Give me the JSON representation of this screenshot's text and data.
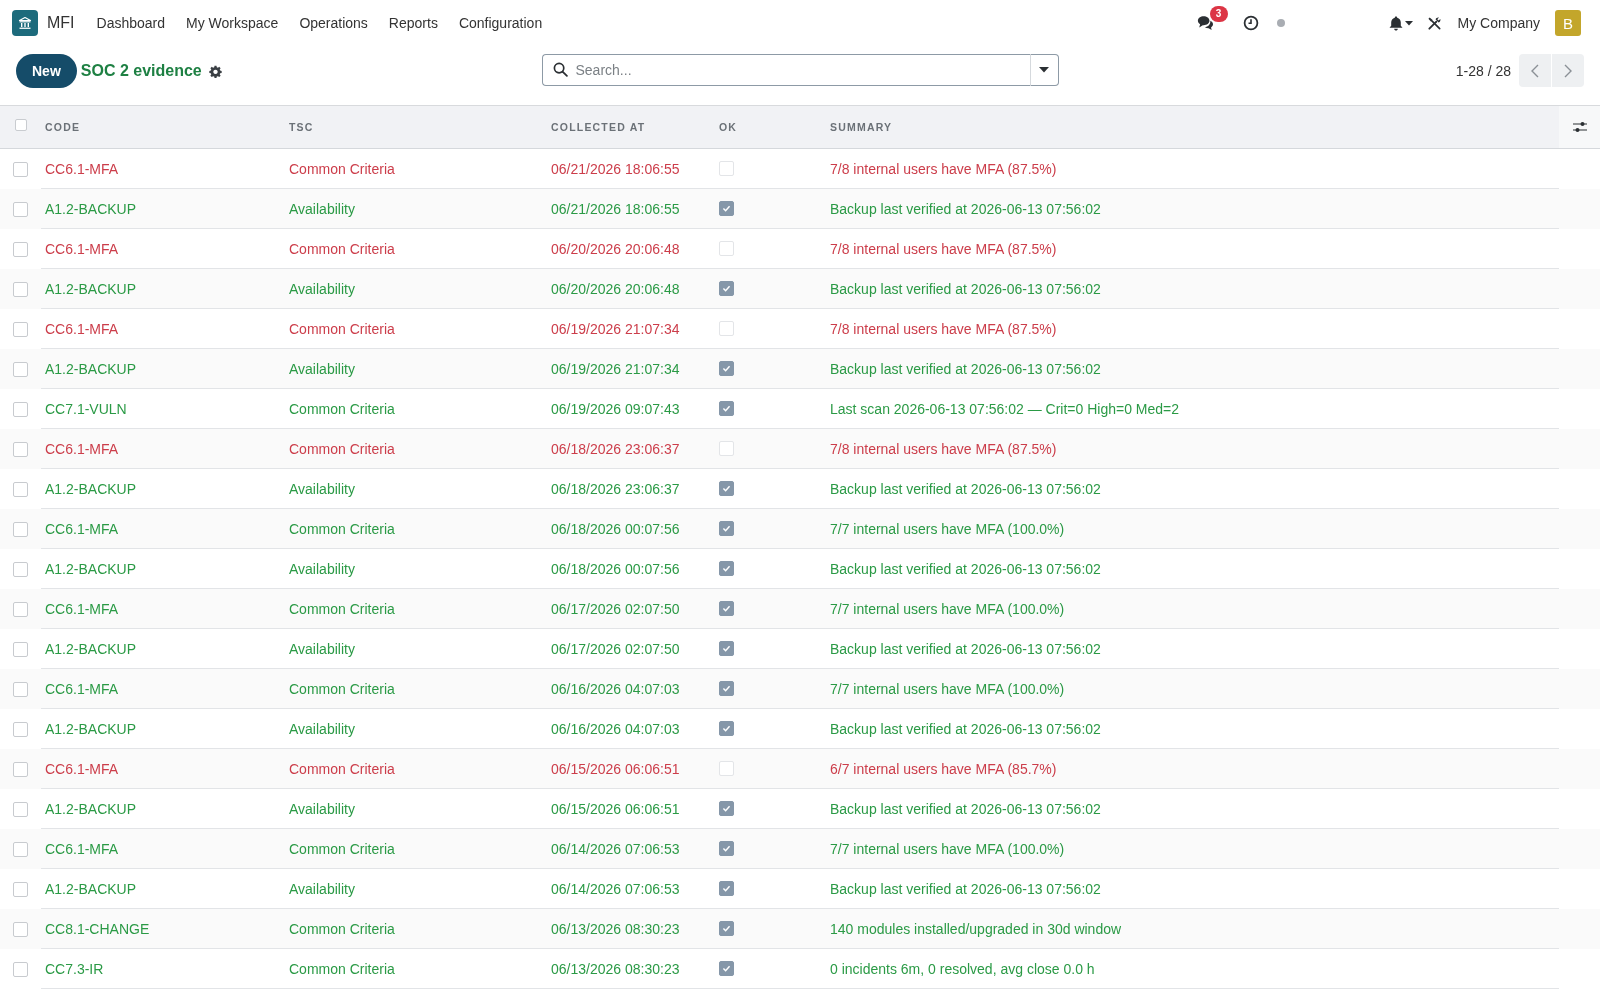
{
  "navbar": {
    "app_name": "MFI",
    "menu": [
      "Dashboard",
      "My Workspace",
      "Operations",
      "Reports",
      "Configuration"
    ],
    "messages_badge": "3",
    "company": "My Company",
    "avatar_initial": "B"
  },
  "control_panel": {
    "new_button": "New",
    "title": "SOC 2 evidence",
    "search": {
      "placeholder": "Search..."
    },
    "pager": "1-28 / 28"
  },
  "table": {
    "select_all": false,
    "columns": [
      "CODE",
      "TSC",
      "COLLECTED AT",
      "OK",
      "SUMMARY"
    ],
    "rows": [
      {
        "selected": false,
        "code": "CC6.1-MFA",
        "tsc": "Common Criteria",
        "collected_at": "06/21/2026 18:06:55",
        "ok": false,
        "summary": "7/8 internal users have MFA (87.5%)"
      },
      {
        "selected": false,
        "code": "A1.2-BACKUP",
        "tsc": "Availability",
        "collected_at": "06/21/2026 18:06:55",
        "ok": true,
        "summary": "Backup last verified at 2026-06-13 07:56:02"
      },
      {
        "selected": false,
        "code": "CC6.1-MFA",
        "tsc": "Common Criteria",
        "collected_at": "06/20/2026 20:06:48",
        "ok": false,
        "summary": "7/8 internal users have MFA (87.5%)"
      },
      {
        "selected": false,
        "code": "A1.2-BACKUP",
        "tsc": "Availability",
        "collected_at": "06/20/2026 20:06:48",
        "ok": true,
        "summary": "Backup last verified at 2026-06-13 07:56:02"
      },
      {
        "selected": false,
        "code": "CC6.1-MFA",
        "tsc": "Common Criteria",
        "collected_at": "06/19/2026 21:07:34",
        "ok": false,
        "summary": "7/8 internal users have MFA (87.5%)"
      },
      {
        "selected": false,
        "code": "A1.2-BACKUP",
        "tsc": "Availability",
        "collected_at": "06/19/2026 21:07:34",
        "ok": true,
        "summary": "Backup last verified at 2026-06-13 07:56:02"
      },
      {
        "selected": false,
        "code": "CC7.1-VULN",
        "tsc": "Common Criteria",
        "collected_at": "06/19/2026 09:07:43",
        "ok": true,
        "summary": "Last scan 2026-06-13 07:56:02 — Crit=0 High=0 Med=2"
      },
      {
        "selected": false,
        "code": "CC6.1-MFA",
        "tsc": "Common Criteria",
        "collected_at": "06/18/2026 23:06:37",
        "ok": false,
        "summary": "7/8 internal users have MFA (87.5%)"
      },
      {
        "selected": false,
        "code": "A1.2-BACKUP",
        "tsc": "Availability",
        "collected_at": "06/18/2026 23:06:37",
        "ok": true,
        "summary": "Backup last verified at 2026-06-13 07:56:02"
      },
      {
        "selected": false,
        "code": "CC6.1-MFA",
        "tsc": "Common Criteria",
        "collected_at": "06/18/2026 00:07:56",
        "ok": true,
        "summary": "7/7 internal users have MFA (100.0%)"
      },
      {
        "selected": false,
        "code": "A1.2-BACKUP",
        "tsc": "Availability",
        "collected_at": "06/18/2026 00:07:56",
        "ok": true,
        "summary": "Backup last verified at 2026-06-13 07:56:02"
      },
      {
        "selected": false,
        "code": "CC6.1-MFA",
        "tsc": "Common Criteria",
        "collected_at": "06/17/2026 02:07:50",
        "ok": true,
        "summary": "7/7 internal users have MFA (100.0%)"
      },
      {
        "selected": false,
        "code": "A1.2-BACKUP",
        "tsc": "Availability",
        "collected_at": "06/17/2026 02:07:50",
        "ok": true,
        "summary": "Backup last verified at 2026-06-13 07:56:02"
      },
      {
        "selected": false,
        "code": "CC6.1-MFA",
        "tsc": "Common Criteria",
        "collected_at": "06/16/2026 04:07:03",
        "ok": true,
        "summary": "7/7 internal users have MFA (100.0%)"
      },
      {
        "selected": false,
        "code": "A1.2-BACKUP",
        "tsc": "Availability",
        "collected_at": "06/16/2026 04:07:03",
        "ok": true,
        "summary": "Backup last verified at 2026-06-13 07:56:02"
      },
      {
        "selected": false,
        "code": "CC6.1-MFA",
        "tsc": "Common Criteria",
        "collected_at": "06/15/2026 06:06:51",
        "ok": false,
        "summary": "6/7 internal users have MFA (85.7%)"
      },
      {
        "selected": false,
        "code": "A1.2-BACKUP",
        "tsc": "Availability",
        "collected_at": "06/15/2026 06:06:51",
        "ok": true,
        "summary": "Backup last verified at 2026-06-13 07:56:02"
      },
      {
        "selected": false,
        "code": "CC6.1-MFA",
        "tsc": "Common Criteria",
        "collected_at": "06/14/2026 07:06:53",
        "ok": true,
        "summary": "7/7 internal users have MFA (100.0%)"
      },
      {
        "selected": false,
        "code": "A1.2-BACKUP",
        "tsc": "Availability",
        "collected_at": "06/14/2026 07:06:53",
        "ok": true,
        "summary": "Backup last verified at 2026-06-13 07:56:02"
      },
      {
        "selected": false,
        "code": "CC8.1-CHANGE",
        "tsc": "Common Criteria",
        "collected_at": "06/13/2026 08:30:23",
        "ok": true,
        "summary": "140 modules installed/upgraded in 30d window"
      },
      {
        "selected": false,
        "code": "CC7.3-IR",
        "tsc": "Common Criteria",
        "collected_at": "06/13/2026 08:30:23",
        "ok": true,
        "summary": "0 incidents 6m, 0 resolved, avg close 0.0 h"
      }
    ]
  }
}
